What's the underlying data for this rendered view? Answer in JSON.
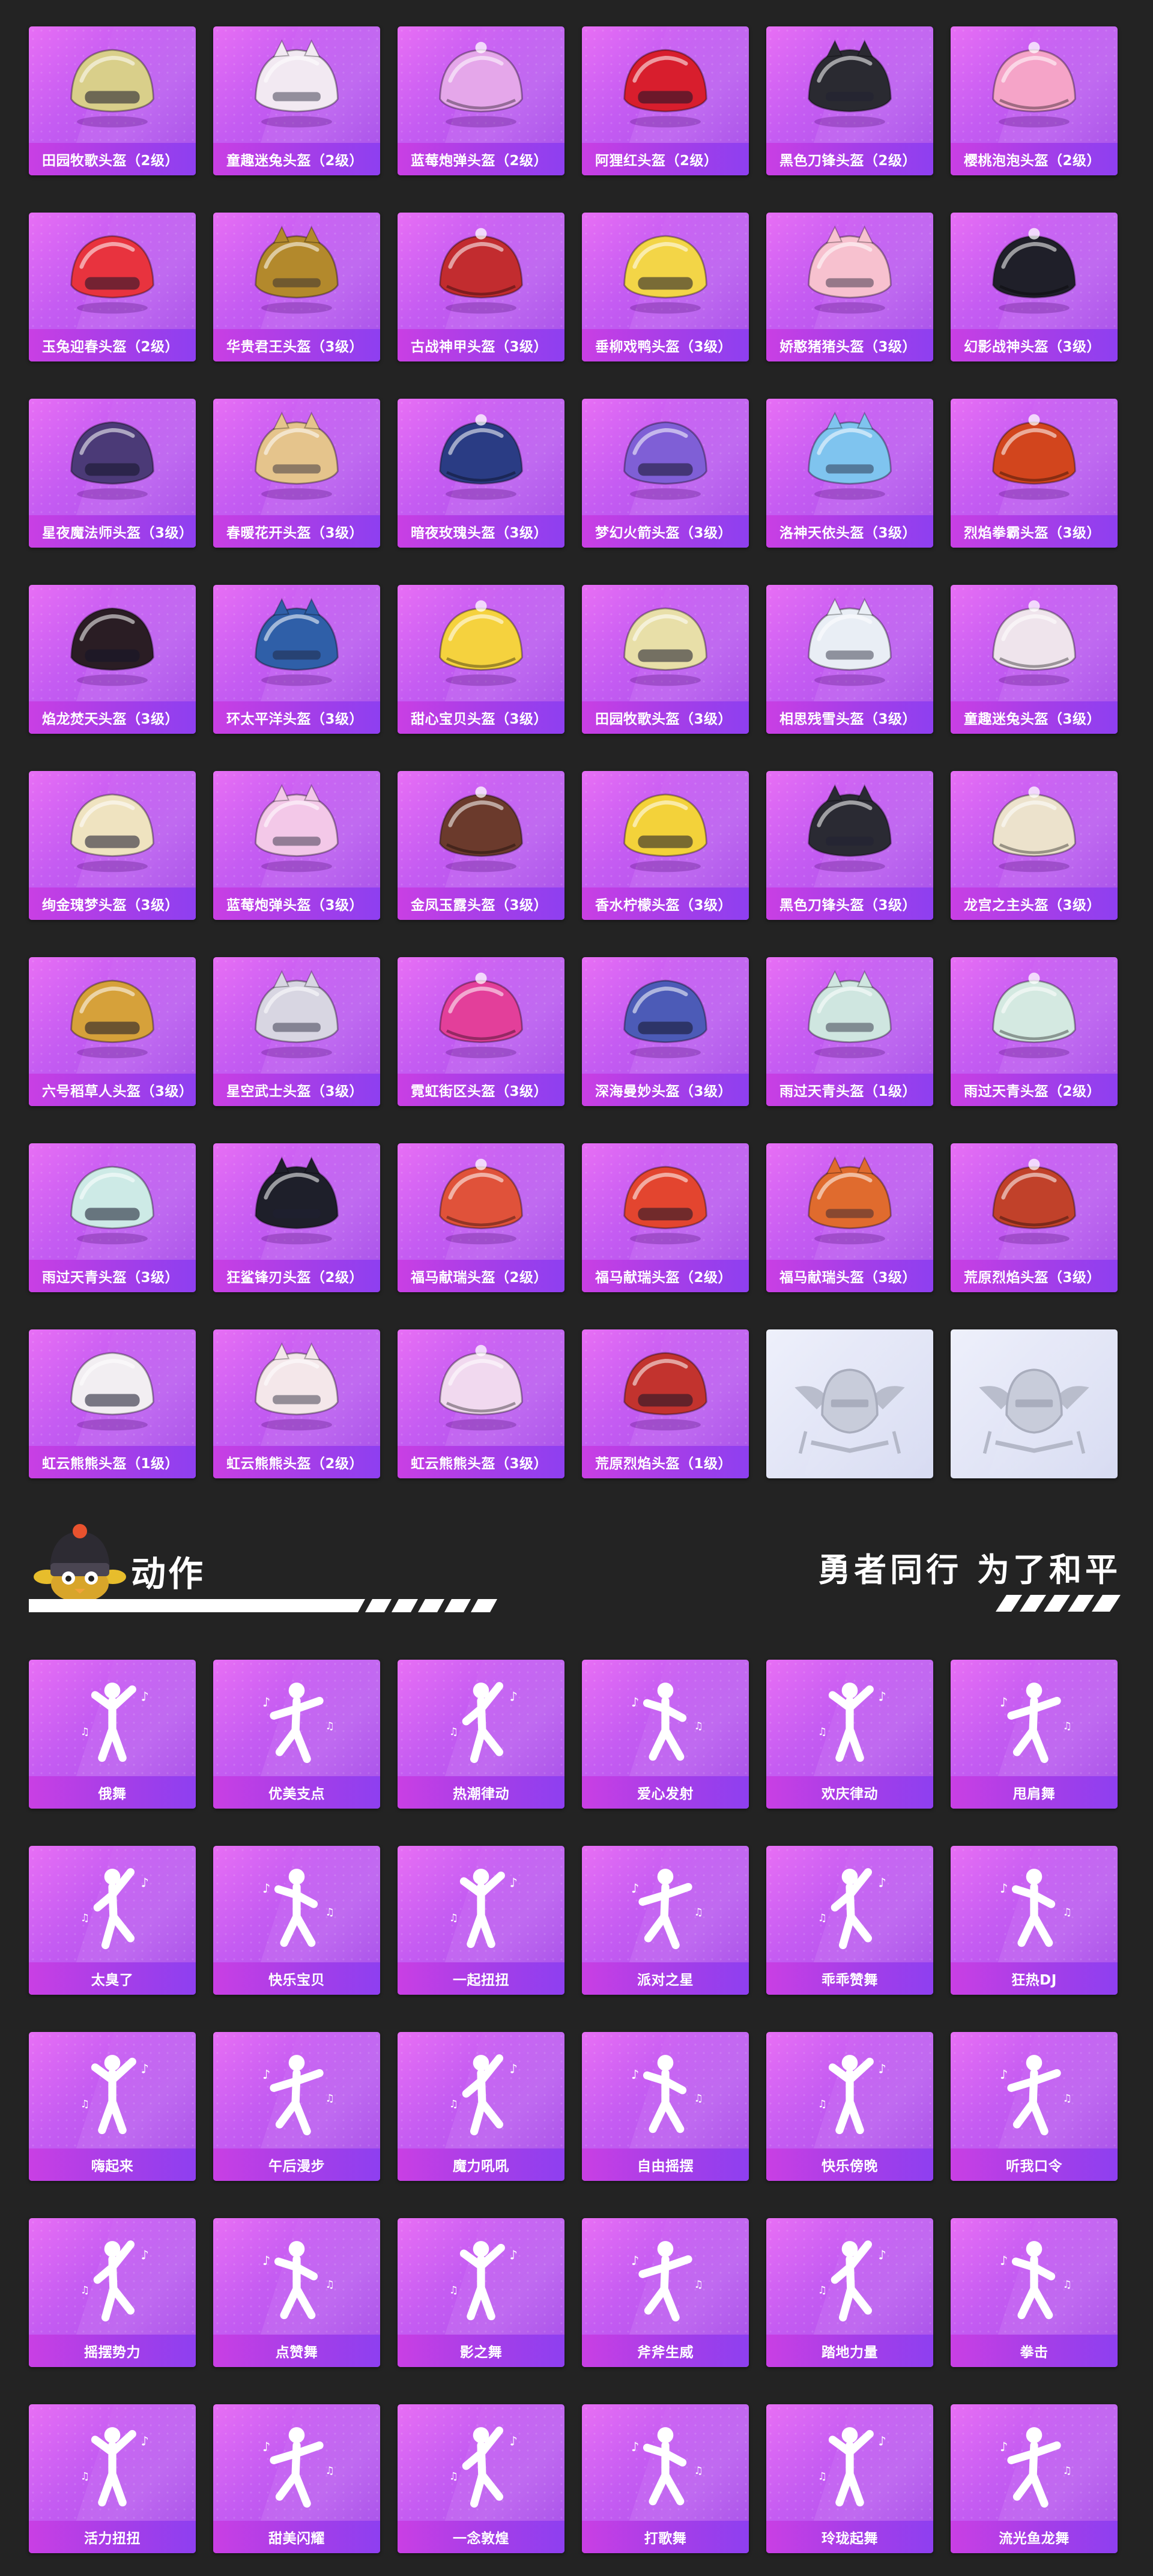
{
  "helmets": [
    {
      "label": "田园牧歌头盔（2级）",
      "color": "#d9cf8a",
      "icon": "helmet-icon"
    },
    {
      "label": "童趣迷兔头盔（2级）",
      "color": "#f2e9f2",
      "icon": "helmet-icon"
    },
    {
      "label": "蓝莓炮弹头盔（2级）",
      "color": "#e5a7ea",
      "icon": "helmet-icon"
    },
    {
      "label": "阿狸红头盔（2级）",
      "color": "#d81e2d",
      "icon": "helmet-icon"
    },
    {
      "label": "黑色刀锋头盔（2级）",
      "color": "#2a2a31",
      "icon": "helmet-icon"
    },
    {
      "label": "樱桃泡泡头盔（2级）",
      "color": "#f5a4c8",
      "icon": "helmet-icon"
    },
    {
      "label": "玉兔迎春头盔（2级）",
      "color": "#e8333e",
      "icon": "helmet-icon"
    },
    {
      "label": "华贵君王头盔（3级）",
      "color": "#b3892c",
      "icon": "helmet-icon"
    },
    {
      "label": "古战神甲头盔（3级）",
      "color": "#c22c2f",
      "icon": "helmet-icon"
    },
    {
      "label": "垂柳戏鸭头盔（3级）",
      "color": "#f3d547",
      "icon": "helmet-icon"
    },
    {
      "label": "娇憨猪猪头盔（3级）",
      "color": "#f7c1cf",
      "icon": "helmet-icon"
    },
    {
      "label": "幻影战神头盔（3级）",
      "color": "#1f1f29",
      "icon": "helmet-icon"
    },
    {
      "label": "星夜魔法师头盔（3级）",
      "color": "#4b3a77",
      "icon": "helmet-icon"
    },
    {
      "label": "春暖花开头盔（3级）",
      "color": "#e5c48c",
      "icon": "helmet-icon"
    },
    {
      "label": "暗夜玫瑰头盔（3级）",
      "color": "#2a3c84",
      "icon": "helmet-icon"
    },
    {
      "label": "梦幻火箭头盔（3级）",
      "color": "#7f5fd6",
      "icon": "helmet-icon"
    },
    {
      "label": "洛神天依头盔（3级）",
      "color": "#7fc4ef",
      "icon": "helmet-icon"
    },
    {
      "label": "烈焰拳霸头盔（3级）",
      "color": "#d2451d",
      "icon": "helmet-icon"
    },
    {
      "label": "焰龙焚天头盔（3级）",
      "color": "#2a1d24",
      "icon": "helmet-icon"
    },
    {
      "label": "环太平洋头盔（3级）",
      "color": "#2f5fa8",
      "icon": "helmet-icon"
    },
    {
      "label": "甜心宝贝头盔（3级）",
      "color": "#f5d23e",
      "icon": "helmet-icon"
    },
    {
      "label": "田园牧歌头盔（3级）",
      "color": "#e8dfa8",
      "icon": "helmet-icon"
    },
    {
      "label": "相思残雪头盔（3级）",
      "color": "#e9eef5",
      "icon": "helmet-icon"
    },
    {
      "label": "童趣迷兔头盔（3级）",
      "color": "#efe4ec",
      "icon": "helmet-icon"
    },
    {
      "label": "绚金瑰梦头盔（3级）",
      "color": "#efe3c0",
      "icon": "helmet-icon"
    },
    {
      "label": "蓝莓炮弹头盔（3级）",
      "color": "#f3c8e8",
      "icon": "helmet-icon"
    },
    {
      "label": "金凤玉露头盔（3级）",
      "color": "#6b3a2c",
      "icon": "helmet-icon"
    },
    {
      "label": "香水柠檬头盔（3级）",
      "color": "#f3d23a",
      "icon": "helmet-icon"
    },
    {
      "label": "黑色刀锋头盔（3级）",
      "color": "#2a2a33",
      "icon": "helmet-icon"
    },
    {
      "label": "龙宫之主头盔（3级）",
      "color": "#ece2cc",
      "icon": "helmet-icon"
    },
    {
      "label": "六号稻草人头盔（3级）",
      "color": "#d6a13a",
      "icon": "helmet-icon"
    },
    {
      "label": "星空武士头盔（3级）",
      "color": "#d8d6e2",
      "icon": "helmet-icon"
    },
    {
      "label": "霓虹街区头盔（3级）",
      "color": "#e33f9a",
      "icon": "helmet-icon"
    },
    {
      "label": "深海曼妙头盔（3级）",
      "color": "#4c5bb7",
      "icon": "helmet-icon"
    },
    {
      "label": "雨过天青头盔（1级）",
      "color": "#cfe6e0",
      "icon": "helmet-icon"
    },
    {
      "label": "雨过天青头盔（2级）",
      "color": "#d4e9e1",
      "icon": "helmet-icon"
    },
    {
      "label": "雨过天青头盔（3级）",
      "color": "#cdeae6",
      "icon": "helmet-icon"
    },
    {
      "label": "狂鲨锋刃头盔（2级）",
      "color": "#1e1f2a",
      "icon": "helmet-icon"
    },
    {
      "label": "福马献瑞头盔（2级）",
      "color": "#e0523a",
      "icon": "helmet-icon"
    },
    {
      "label": "福马献瑞头盔（2级）",
      "color": "#e3452f",
      "icon": "helmet-icon"
    },
    {
      "label": "福马献瑞头盔（3级）",
      "color": "#e06b2e",
      "icon": "helmet-icon"
    },
    {
      "label": "荒原烈焰头盔（3级）",
      "color": "#c1412a",
      "icon": "helmet-icon"
    },
    {
      "label": "虹云熊熊头盔（1级）",
      "color": "#f2eef2",
      "icon": "helmet-icon"
    },
    {
      "label": "虹云熊熊头盔（2级）",
      "color": "#f4e7ea",
      "icon": "helmet-icon"
    },
    {
      "label": "虹云熊熊头盔（3级）",
      "color": "#f1d9ef",
      "icon": "helmet-icon"
    },
    {
      "label": "荒原烈焰头盔（1级）",
      "color": "#c2332e",
      "icon": "helmet-icon"
    },
    {
      "label": "",
      "color": "#c9ccdc",
      "icon": "emblem-icon",
      "placeholder": true
    },
    {
      "label": "",
      "color": "#c9ccdc",
      "icon": "emblem-icon",
      "placeholder": true
    }
  ],
  "section": {
    "title": "动作",
    "slogan": "勇者同行 为了和平",
    "mascot_icon": "mascot-icon"
  },
  "actions": [
    {
      "label": "俄舞"
    },
    {
      "label": "优美支点"
    },
    {
      "label": "热潮律动"
    },
    {
      "label": "爱心发射"
    },
    {
      "label": "欢庆律动"
    },
    {
      "label": "甩肩舞"
    },
    {
      "label": "太臭了"
    },
    {
      "label": "快乐宝贝"
    },
    {
      "label": "一起扭扭"
    },
    {
      "label": "派对之星"
    },
    {
      "label": "乖乖赞舞"
    },
    {
      "label": "狂热DJ"
    },
    {
      "label": "嗨起来"
    },
    {
      "label": "午后漫步"
    },
    {
      "label": "魔力吼吼"
    },
    {
      "label": "自由摇摆"
    },
    {
      "label": "快乐傍晚"
    },
    {
      "label": "听我口令"
    },
    {
      "label": "摇摆势力"
    },
    {
      "label": "点赞舞"
    },
    {
      "label": "影之舞"
    },
    {
      "label": "斧斧生威"
    },
    {
      "label": "踏地力量"
    },
    {
      "label": "拳击"
    },
    {
      "label": "活力扭扭"
    },
    {
      "label": "甜美闪耀"
    },
    {
      "label": "一念敦煌"
    },
    {
      "label": "打歌舞"
    },
    {
      "label": "玲珑起舞"
    },
    {
      "label": "流光鱼龙舞"
    }
  ],
  "colors": {
    "background": "#232323",
    "card_gradient_start": "#e86ff5",
    "card_gradient_end": "#a24be8",
    "label_bar": "#a53ee8",
    "text": "#ffffff"
  }
}
